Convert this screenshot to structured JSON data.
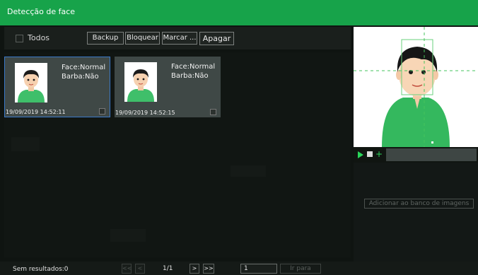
{
  "window": {
    "title": "Detecção de face"
  },
  "toolbar": {
    "select_all_label": "Todos",
    "backup_label": "Backup",
    "lock_label": "Bloquear",
    "mark_label": "Marcar ...",
    "delete_label": "Apagar"
  },
  "results": [
    {
      "face": "Face:Normal",
      "beard": "Barba:Não",
      "timestamp": "19/09/2019 14:52:11",
      "selected": true
    },
    {
      "face": "Face:Normal",
      "beard": "Barba:Não",
      "timestamp": "19/09/2019 14:52:15",
      "selected": false
    }
  ],
  "preview": {
    "add_to_library_label": "Adicionar ao banco de imagens"
  },
  "footer": {
    "results_label": "Sem resultados:0",
    "first_label": "<<",
    "prev_label": "<",
    "page_info": "1/1",
    "next_label": ">",
    "last_label": ">>",
    "page_input_value": "1",
    "goto_label": "Ir para"
  },
  "colors": {
    "title_bar": "#17a34a",
    "selection": "#3b79c9",
    "player_accent": "#2ad65a"
  }
}
